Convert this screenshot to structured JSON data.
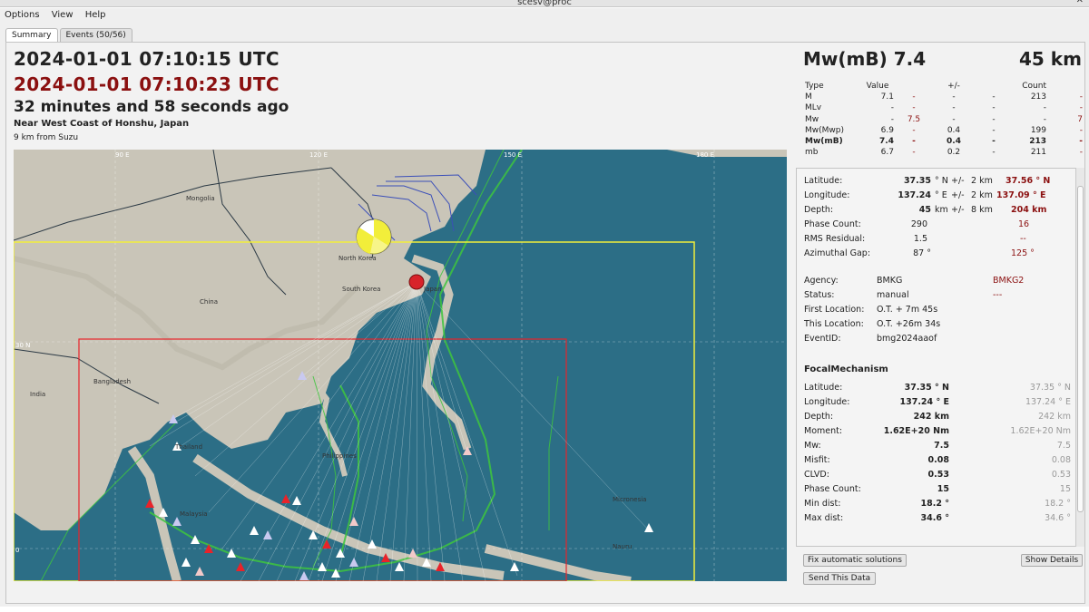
{
  "window": {
    "title": "scesv@proc"
  },
  "menu": [
    "Options",
    "View",
    "Help"
  ],
  "tabs": [
    "Summary",
    "Events (50/56)"
  ],
  "header": {
    "origin_time": "2024-01-01 07:10:15 UTC",
    "origin_time_alt": "2024-01-01 07:10:23 UTC",
    "elapsed": "32 minutes and 58 seconds ago",
    "region": "Near West Coast of Honshu, Japan",
    "distance": "9 km from Suzu"
  },
  "summary": {
    "magnitude": "Mw(mB) 7.4",
    "depth": "45 km"
  },
  "magnitudes": {
    "headers": [
      "Type",
      "Value",
      "+/-",
      "Count"
    ],
    "rows": [
      {
        "type": "M",
        "v": "7.1",
        "v2": "-",
        "u": "-",
        "u2": "-",
        "c": "213",
        "c2": "-"
      },
      {
        "type": "MLv",
        "v": "-",
        "v2": "-",
        "u": "-",
        "u2": "-",
        "c": "-",
        "c2": "-"
      },
      {
        "type": "Mw",
        "v": "-",
        "v2": "7.5",
        "u": "-",
        "u2": "-",
        "c": "-",
        "c2": "7"
      },
      {
        "type": "Mw(Mwp)",
        "v": "6.9",
        "v2": "-",
        "u": "0.4",
        "u2": "-",
        "c": "199",
        "c2": "-"
      },
      {
        "type": "Mw(mB)",
        "v": "7.4",
        "v2": "-",
        "u": "0.4",
        "u2": "-",
        "c": "213",
        "c2": "-"
      },
      {
        "type": "mb",
        "v": "6.7",
        "v2": "-",
        "u": "0.2",
        "u2": "-",
        "c": "211",
        "c2": "-"
      }
    ]
  },
  "origin": {
    "latitude": {
      "label": "Latitude:",
      "value": "37.35",
      "unit": "° N",
      "pm": "+/-",
      "err": "2 km",
      "alt": "37.56 ° N"
    },
    "longitude": {
      "label": "Longitude:",
      "value": "137.24",
      "unit": "° E",
      "pm": "+/-",
      "err": "2 km",
      "alt": "137.09 ° E"
    },
    "depth": {
      "label": "Depth:",
      "value": "45",
      "unit": "km",
      "pm": "+/-",
      "err": "8 km",
      "alt": "204 km"
    },
    "phase_count": {
      "label": "Phase Count:",
      "value": "290",
      "alt": "16"
    },
    "rms": {
      "label": "RMS Residual:",
      "value": "1.5",
      "alt": "--"
    },
    "gap": {
      "label": "Azimuthal Gap:",
      "value": "87 °",
      "alt": "125 °"
    },
    "agency": {
      "label": "Agency:",
      "value": "BMKG",
      "alt": "BMKG2"
    },
    "status": {
      "label": "Status:",
      "value": "manual",
      "alt": "---"
    },
    "first_location": {
      "label": "First Location:",
      "value": "O.T. + 7m 45s"
    },
    "this_location": {
      "label": "This Location:",
      "value": "O.T. +26m 34s"
    },
    "event_id": {
      "label": "EventID:",
      "value": "bmg2024aaof"
    }
  },
  "focal_mechanism": {
    "title": "FocalMechanism",
    "rows": [
      {
        "label": "Latitude:",
        "value": "37.35 ° N",
        "alt": "37.35 ° N"
      },
      {
        "label": "Longitude:",
        "value": "137.24 ° E",
        "alt": "137.24 ° E"
      },
      {
        "label": "Depth:",
        "value": "242 km",
        "alt": "242 km"
      },
      {
        "label": "Moment:",
        "value": "1.62E+20 Nm",
        "alt": "1.62E+20 Nm"
      },
      {
        "label": "Mw:",
        "value": "7.5",
        "alt": "7.5"
      },
      {
        "label": "Misfit:",
        "value": "0.08",
        "alt": "0.08"
      },
      {
        "label": "CLVD:",
        "value": "0.53",
        "alt": "0.53"
      },
      {
        "label": "Phase Count:",
        "value": "15",
        "alt": "15"
      },
      {
        "label": "Min dist:",
        "value": "18.2 °",
        "alt": "18.2 °"
      },
      {
        "label": "Max dist:",
        "value": "34.6 °",
        "alt": "34.6 °"
      }
    ]
  },
  "buttons": {
    "fix": "Fix automatic solutions",
    "details": "Show Details",
    "send": "Send This Data"
  },
  "map": {
    "lon_labels": [
      "90 E",
      "120 E",
      "150 E",
      "180 E"
    ],
    "lat_labels": [
      "30 N",
      "0"
    ],
    "places": [
      "Mongolia",
      "China",
      "India",
      "Bangladesh",
      "North Korea",
      "South Korea",
      "Japan",
      "Thailand",
      "Malaysia",
      "Philippines",
      "Micronesia",
      "Nauru"
    ],
    "colors": {
      "ocean": "#2c6e86",
      "land": "#c9c5b8",
      "epicenter": "#d8232a",
      "region_yellow": "#f2ee3a",
      "region_red": "#e8232a",
      "plate_green": "#3ec63e"
    }
  }
}
